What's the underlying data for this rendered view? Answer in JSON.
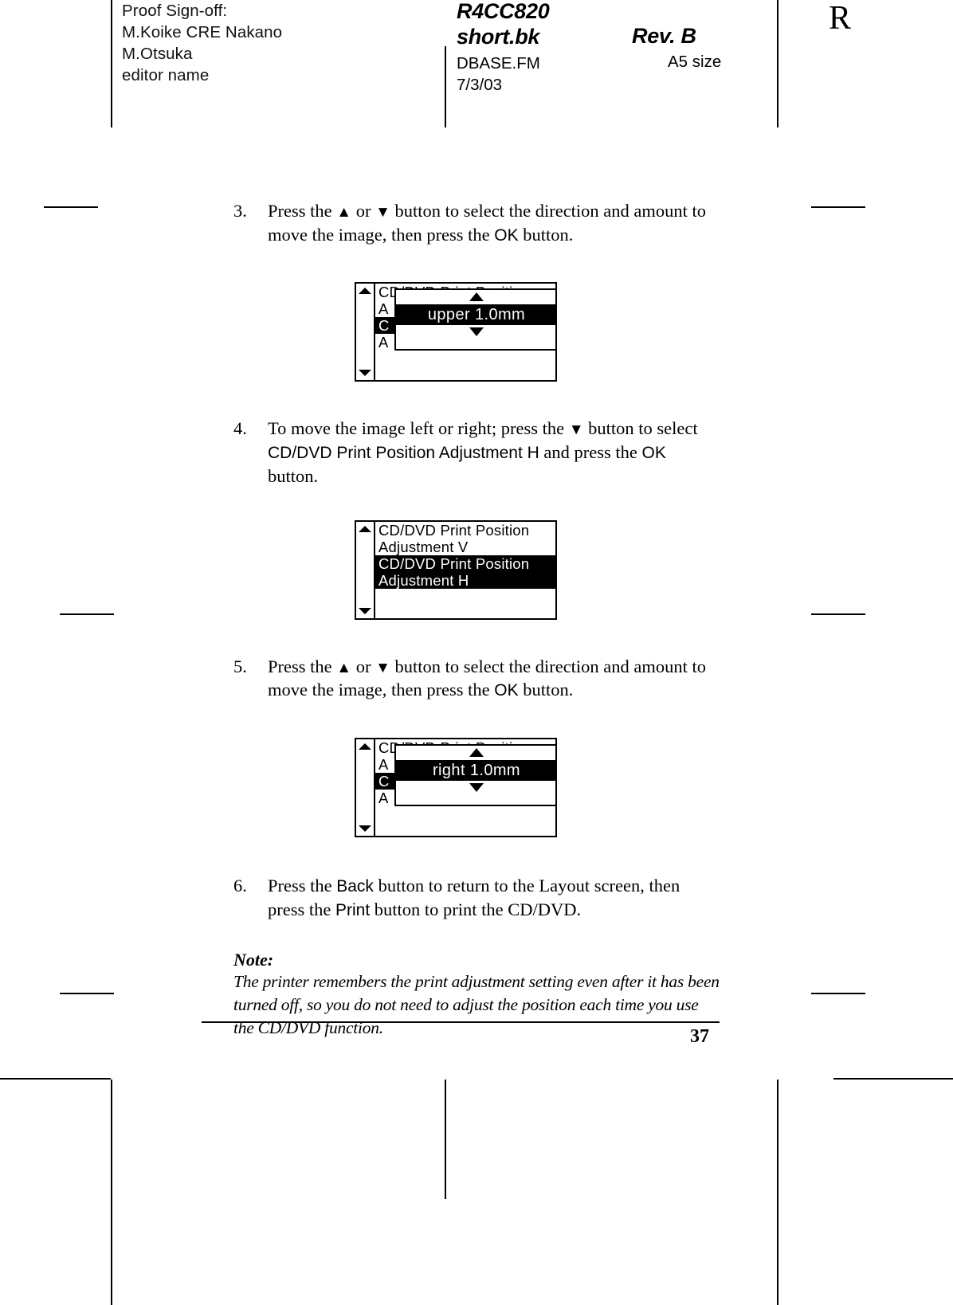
{
  "proof_header": {
    "signoff_lines": [
      "Proof Sign-off:",
      "M.Koike CRE Nakano",
      "M.Otsuka",
      "editor name"
    ],
    "doc_title_line1": "R4CC820",
    "doc_title_line2": "short.bk",
    "revision": "Rev. B",
    "file_name": "DBASE.FM",
    "file_date": "7/3/03",
    "paper_size": "A5 size",
    "rev_mark": "R"
  },
  "steps": [
    {
      "number": "3.",
      "parts": [
        {
          "t": "Press the ",
          "s": "serif"
        },
        {
          "t": "▲",
          "s": "tri"
        },
        {
          "t": " or ",
          "s": "serif"
        },
        {
          "t": "▼",
          "s": "tri"
        },
        {
          "t": " button to select the direction and amount to move the image, then press the ",
          "s": "serif"
        },
        {
          "t": "OK",
          "s": "ui"
        },
        {
          "t": " button.",
          "s": "serif"
        }
      ]
    },
    {
      "number": "4.",
      "parts": [
        {
          "t": "To move the image left or right; press the ",
          "s": "serif"
        },
        {
          "t": "▼",
          "s": "tri"
        },
        {
          "t": " button to select ",
          "s": "serif"
        },
        {
          "t": "CD/DVD Print Position Adjustment H",
          "s": "ui"
        },
        {
          "t": " and press the ",
          "s": "serif"
        },
        {
          "t": "OK",
          "s": "ui"
        },
        {
          "t": " button.",
          "s": "serif"
        }
      ]
    },
    {
      "number": "5.",
      "parts": [
        {
          "t": "Press the ",
          "s": "serif"
        },
        {
          "t": "▲",
          "s": "tri"
        },
        {
          "t": " or ",
          "s": "serif"
        },
        {
          "t": "▼",
          "s": "tri"
        },
        {
          "t": " button to select the direction and amount to move the image, then press the ",
          "s": "serif"
        },
        {
          "t": "OK",
          "s": "ui"
        },
        {
          "t": " button.",
          "s": "serif"
        }
      ]
    },
    {
      "number": "6.",
      "parts": [
        {
          "t": "Press the ",
          "s": "serif"
        },
        {
          "t": "Back",
          "s": "ui"
        },
        {
          "t": " button to return to the Layout screen, then press the ",
          "s": "serif"
        },
        {
          "t": "Print",
          "s": "ui"
        },
        {
          "t": " button to print the CD/DVD.",
          "s": "serif"
        }
      ]
    }
  ],
  "lcd_screens": {
    "vertical_adjust": {
      "background_lines": [
        "CD/DVD Print Positi",
        "A",
        "C",
        "A"
      ],
      "popup_value": "upper 1.0mm",
      "up_arrow_icon": "triangle-up-icon",
      "down_arrow_icon": "triangle-down-icon",
      "scroll_up_icon": "scroll-up-icon",
      "scroll_down_icon": "scroll-down-icon"
    },
    "menu_list": {
      "items": [
        {
          "text": "CD/DVD Print Position",
          "selected": false
        },
        {
          "text": "Adjustment V",
          "selected": false
        },
        {
          "text": "CD/DVD Print Position",
          "selected": true
        },
        {
          "text": "Adjustment H",
          "selected": true
        }
      ],
      "scroll_up_icon": "scroll-up-icon",
      "scroll_down_icon": "scroll-down-icon"
    },
    "horizontal_adjust": {
      "background_lines": [
        "CD/DVD Print Positi",
        "A",
        "C",
        "A"
      ],
      "popup_value": "right 1.0mm",
      "up_arrow_icon": "triangle-up-icon",
      "down_arrow_icon": "triangle-down-icon",
      "scroll_up_icon": "scroll-up-icon",
      "scroll_down_icon": "scroll-down-icon"
    }
  },
  "note": {
    "heading": "Note:",
    "body": "The printer remembers the print adjustment setting even after it has been turned off, so you do not need to adjust the position each time you use the CD/DVD function."
  },
  "footer": {
    "page_number": "37"
  }
}
